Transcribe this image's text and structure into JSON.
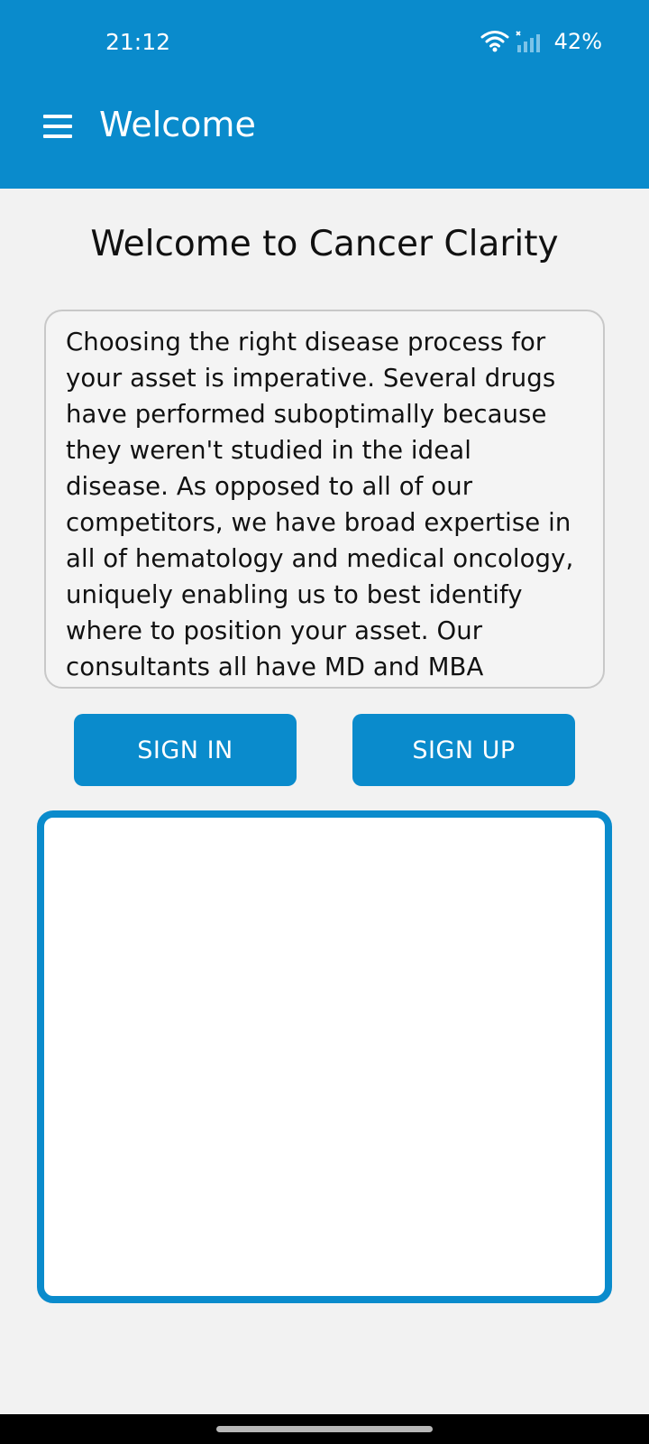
{
  "status_bar": {
    "time": "21:12",
    "battery": "42%",
    "icons": [
      "wifi-icon",
      "signal-icon"
    ]
  },
  "toolbar": {
    "menu_icon": "hamburger-menu-icon",
    "title": "Welcome"
  },
  "main": {
    "heading": "Welcome to Cancer Clarity",
    "description": "Choosing the right disease process for your asset is imperative. Several drugs have performed suboptimally because they weren't studied in the ideal disease. As opposed to all of our competitors, we have broad expertise in all of hematology and medical oncology, uniquely enabling us to best identify where to position your asset. Our consultants all have MD and MBA",
    "sign_in_label": "SIGN IN",
    "sign_up_label": "SIGN UP"
  },
  "colors": {
    "primary": "#0a8bcc",
    "background": "#f2f2f2"
  }
}
